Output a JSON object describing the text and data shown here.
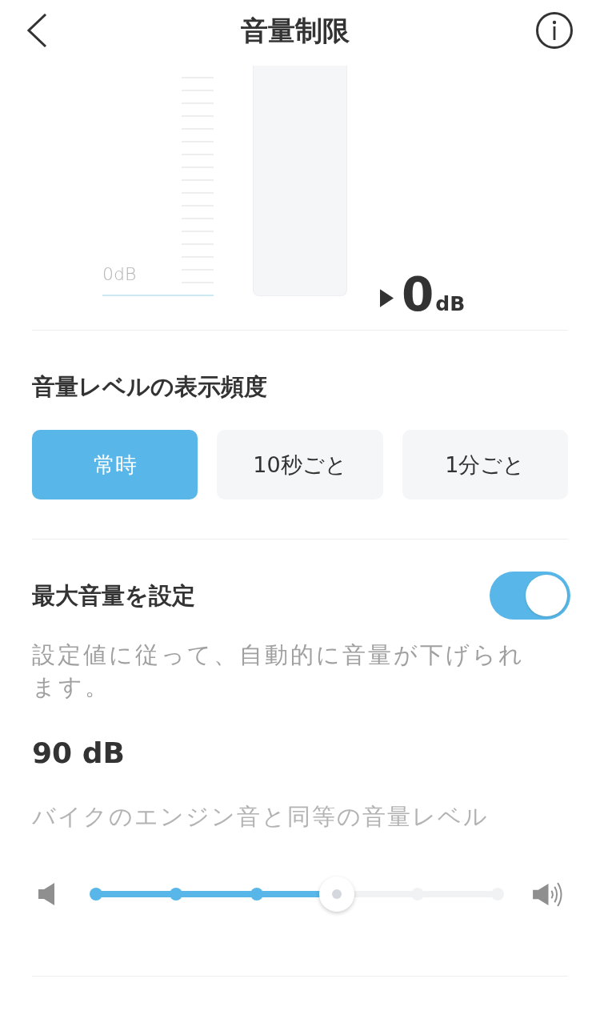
{
  "header": {
    "title": "音量制限"
  },
  "meter": {
    "scale_label": "0dB",
    "reading_value": "0",
    "reading_unit": "dB"
  },
  "frequency": {
    "heading": "音量レベルの表示頻度",
    "options": [
      {
        "label": "常時",
        "selected": true
      },
      {
        "label": "10秒ごと",
        "selected": false
      },
      {
        "label": "1分ごと",
        "selected": false
      }
    ]
  },
  "max_volume": {
    "label": "最大音量を設定",
    "on": true,
    "description": "設定値に従って、自動的に音量が下げられます。",
    "value": "90 dB",
    "comparison": "バイクのエンジン音と同等の音量レベル",
    "slider": {
      "level": 0.6
    }
  }
}
